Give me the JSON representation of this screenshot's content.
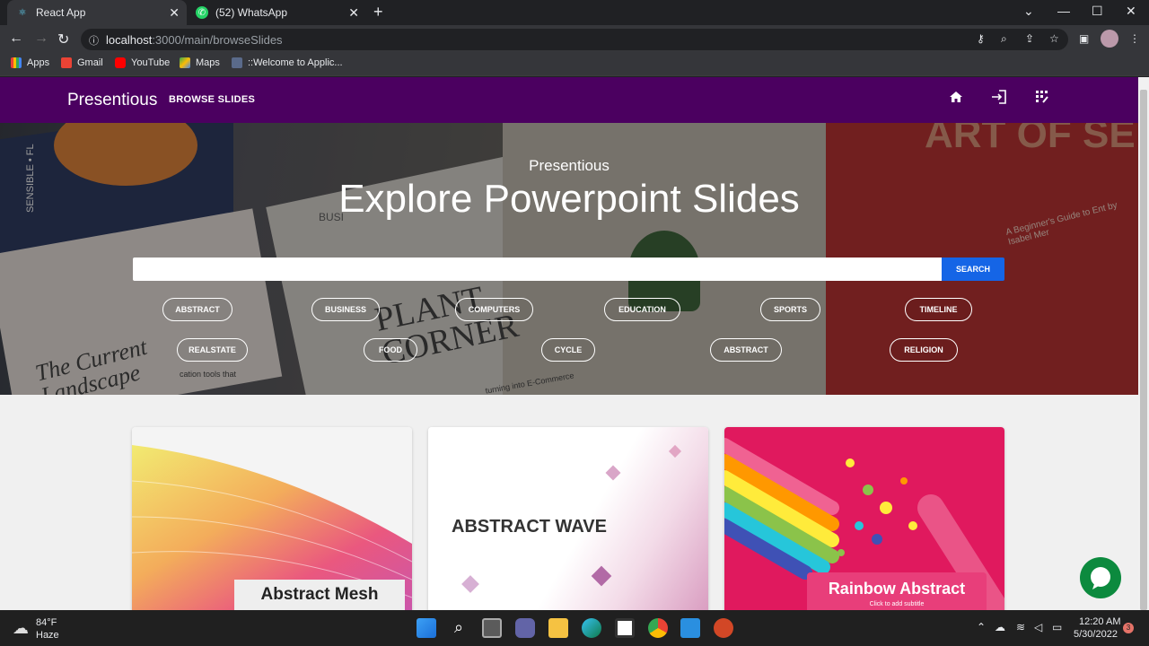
{
  "browser": {
    "tabs": [
      {
        "title": "React App",
        "active": true,
        "icon": "react-icon"
      },
      {
        "title": "(52) WhatsApp",
        "active": false,
        "icon": "whatsapp-icon"
      }
    ],
    "url_host": "localhost",
    "url_path": ":3000/main/browseSlides",
    "bookmarks": [
      "Apps",
      "Gmail",
      "YouTube",
      "Maps",
      "::Welcome to Applic..."
    ]
  },
  "navbar": {
    "brand": "Presentious",
    "browse_label": "BROWSE SLIDES",
    "icons": [
      "home-icon",
      "login-icon",
      "dashboard-icon"
    ],
    "background": "#4b0060"
  },
  "hero": {
    "subtitle": "Presentious",
    "title": "Explore Powerpoint Slides",
    "search_placeholder": "",
    "search_label": "SEARCH",
    "chips_row1": [
      "ABSTRACT",
      "BUSINESS",
      "COMPUTERS",
      "EDUCATION",
      "SPORTS",
      "TIMELINE"
    ],
    "chips_row2": [
      "REALSTATE",
      "FOOD",
      "CYCLE",
      "ABSTRACT",
      "RELIGION"
    ],
    "bg_text": [
      "SENSIBLE • FL",
      "BUSI",
      "PLANT CORNER",
      "ART OF SE",
      "A Beginner's Guide to Ent by Isabel Mer",
      "The Current Landscape",
      "cation tools that",
      "turning into E-Commerce"
    ]
  },
  "cards": [
    {
      "label": "Abstract Mesh",
      "sub": ""
    },
    {
      "label": "ABSTRACT WAVE",
      "sub": ""
    },
    {
      "label": "Rainbow Abstract",
      "sub": "Click to add subtitle"
    }
  ],
  "taskbar": {
    "weather_temp": "84°F",
    "weather_desc": "Haze",
    "time": "12:20 AM",
    "date": "5/30/2022",
    "notif_count": "3"
  },
  "colors": {
    "accent": "#1565e6",
    "fab": "#0c8a3e"
  }
}
